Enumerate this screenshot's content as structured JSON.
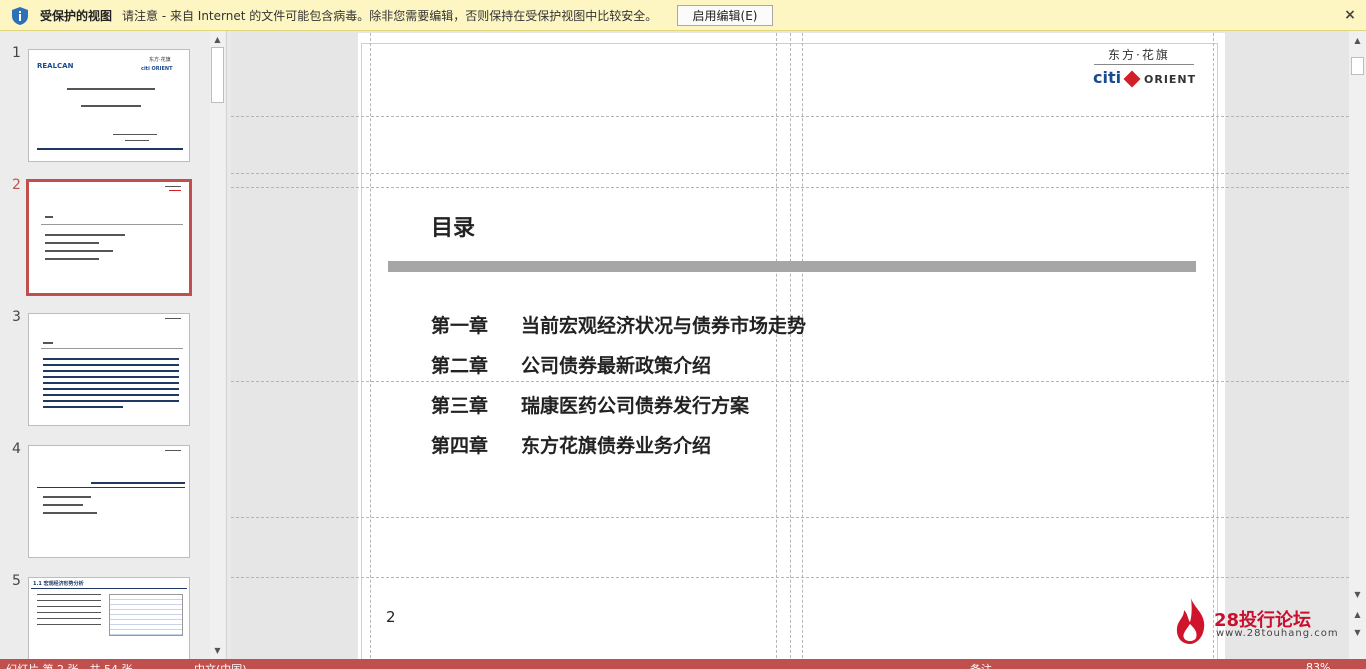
{
  "protected_view": {
    "title": "受保护的视图",
    "message": "请注意 - 来自 Internet 的文件可能包含病毒。除非您需要编辑，否则保持在受保护视图中比较安全。",
    "enable_button": "启用编辑(E)",
    "close": "×"
  },
  "thumbnails": [
    {
      "num": "1",
      "active": false
    },
    {
      "num": "2",
      "active": true
    },
    {
      "num": "3",
      "active": false
    },
    {
      "num": "4",
      "active": false
    },
    {
      "num": "5",
      "active": false
    }
  ],
  "thumb1": {
    "logo_left": "REALCAN",
    "logo_right_cn": "东方·花旗",
    "logo_right_en": "citi ORIENT"
  },
  "thumb5": {
    "title": "1.1 宏观经济形势分析"
  },
  "slide": {
    "logo_cn": "东方·花旗",
    "logo_citi": "citi",
    "logo_orient": "ORIENT",
    "title": "目录",
    "items": [
      {
        "chapter": "第一章",
        "text": "当前宏观经济状况与债券市场走势"
      },
      {
        "chapter": "第二章",
        "text": "公司债券最新政策介绍"
      },
      {
        "chapter": "第三章",
        "text": "瑞康医药公司债券发行方案"
      },
      {
        "chapter": "第四章",
        "text": "东方花旗债券业务介绍"
      }
    ],
    "page_number": "2"
  },
  "watermark": {
    "text": "28投行论坛",
    "url": "www.28touhang.com"
  },
  "status_bar": {
    "slide_info": "幻灯片 第 2 张，共 54 张",
    "language": "中文(中国)",
    "notes": "备注",
    "zoom": "83%"
  },
  "colors": {
    "accent": "#c0504d",
    "pv_bar": "#fdf6c3",
    "toc_bar": "#a6a6a6"
  }
}
